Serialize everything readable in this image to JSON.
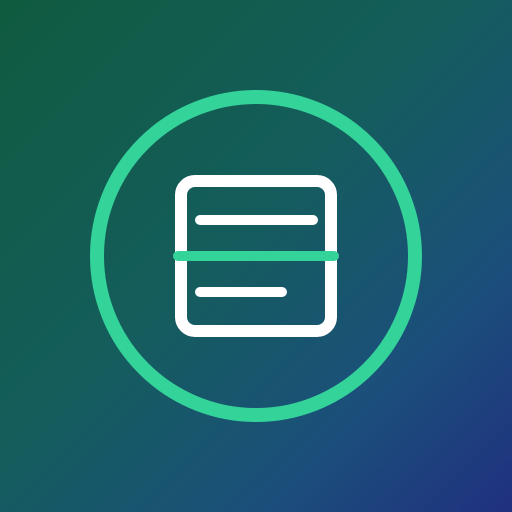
{
  "icon": {
    "name": "document-scan-icon",
    "colors": {
      "background_start": "#0f5b3f",
      "background_mid": "#145d5c",
      "background_end": "#20307f",
      "ring": "#34d399",
      "document_stroke": "#ffffff",
      "scan_line": "#34d399"
    }
  }
}
